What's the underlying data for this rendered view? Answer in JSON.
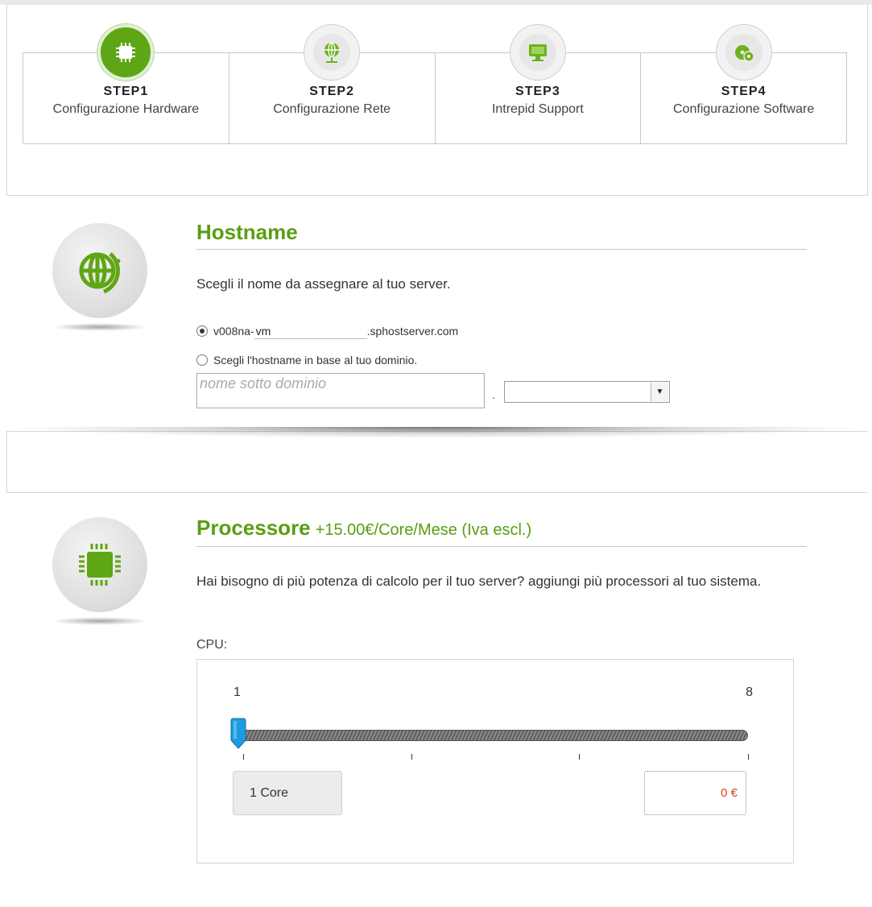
{
  "steps": [
    {
      "num": "STEP1",
      "label": "Configurazione Hardware",
      "icon": "chip-icon",
      "active": true
    },
    {
      "num": "STEP2",
      "label": "Configurazione Rete",
      "icon": "network-globe-icon",
      "active": false
    },
    {
      "num": "STEP3",
      "label": "Intrepid Support",
      "icon": "monitor-icon",
      "active": false
    },
    {
      "num": "STEP4",
      "label": "Configurazione Software",
      "icon": "software-disc-icon",
      "active": false
    }
  ],
  "hostname": {
    "title": "Hostname",
    "description": "Scegli il nome da assegnare al tuo server.",
    "option1_prefix": "v008na-",
    "option1_value": "vm",
    "option1_suffix": ".sphostserver.com",
    "option2_label": "Scegli l'hostname in base al tuo dominio.",
    "subdomain_placeholder": "nome sotto dominio",
    "domain_separator": ".",
    "domain_select_value": ""
  },
  "processor": {
    "title": "Processore",
    "price_note": "+15.00€/Core/Mese (Iva escl.)",
    "description": "Hai bisogno di più potenza di calcolo per il tuo server? aggiungi più processori al tuo sistema.",
    "cpu_label": "CPU:",
    "slider_min": "1",
    "slider_max": "8",
    "slider_value": 1,
    "selected_cores": "1 Core",
    "price": "0 €"
  },
  "colors": {
    "accent_green": "#5a9e12",
    "price_orange": "#d04a10",
    "slider_handle_blue": "#1e9be0"
  }
}
